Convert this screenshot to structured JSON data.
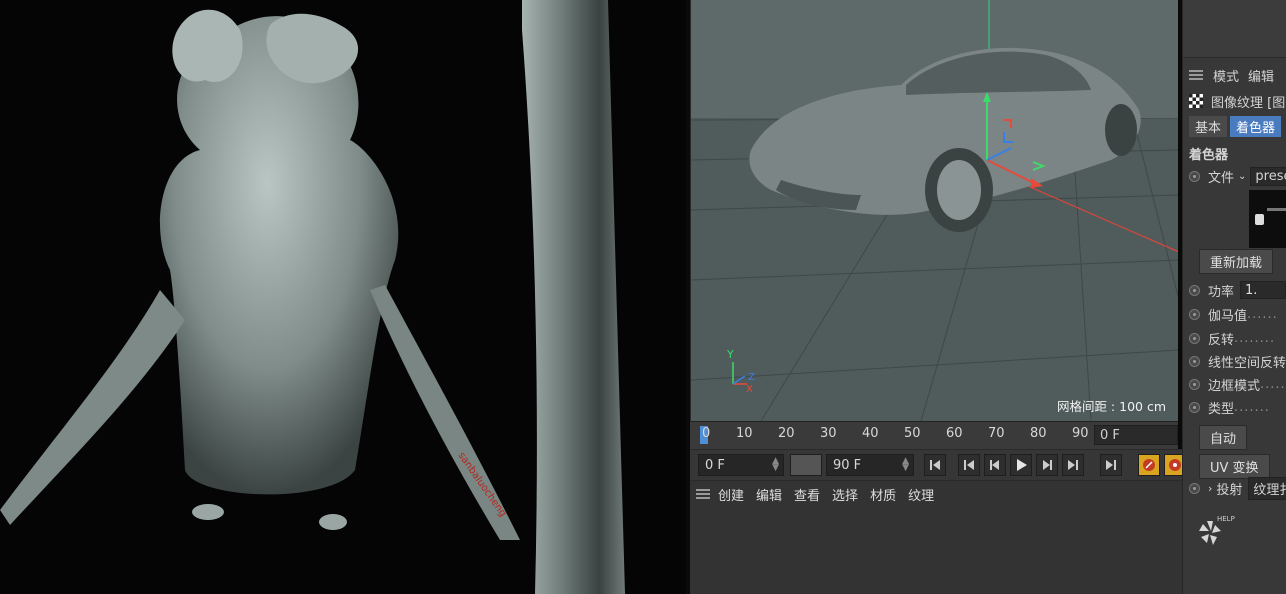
{
  "viewport": {
    "grid_readout": "网格间距 : 100 cm",
    "axis_labels": {
      "y": "Y",
      "z": "Z",
      "x": "X"
    }
  },
  "timeline": {
    "ruler": [
      "0",
      "10",
      "20",
      "30",
      "40",
      "50",
      "60",
      "70",
      "80",
      "90"
    ],
    "current_frame": "0 F"
  },
  "transport": {
    "start": "0 F",
    "end": "90 F"
  },
  "material_manager": {
    "menu": [
      "创建",
      "编辑",
      "查看",
      "选择",
      "材质",
      "纹理"
    ]
  },
  "attributes": {
    "menu": [
      "模式",
      "编辑"
    ],
    "object_title": "图像纹理 [图",
    "tabs": [
      {
        "label": "基本",
        "active": false
      },
      {
        "label": "着色器",
        "active": true
      }
    ],
    "section": "着色器",
    "file_label": "文件",
    "file_value": "prese",
    "reload_button": "重新加载",
    "power_label": "功率",
    "power_value": "1.",
    "gamma_label": "伽马值",
    "invert_label": "反转",
    "linear_invert_label": "线性空间反转",
    "border_label": "边框模式",
    "type_label": "类型",
    "auto_button": "自动",
    "uv_button": "UV 变换",
    "projection_label": "投射",
    "projection_value": "纹理扌",
    "help_label": "HELP"
  },
  "render_watermark": "sanbaluocheng",
  "colors": {
    "accent": "#4b7bbf",
    "viewport_bg": "#505b5b",
    "panel_bg": "#383838",
    "record": "#c23b22"
  }
}
